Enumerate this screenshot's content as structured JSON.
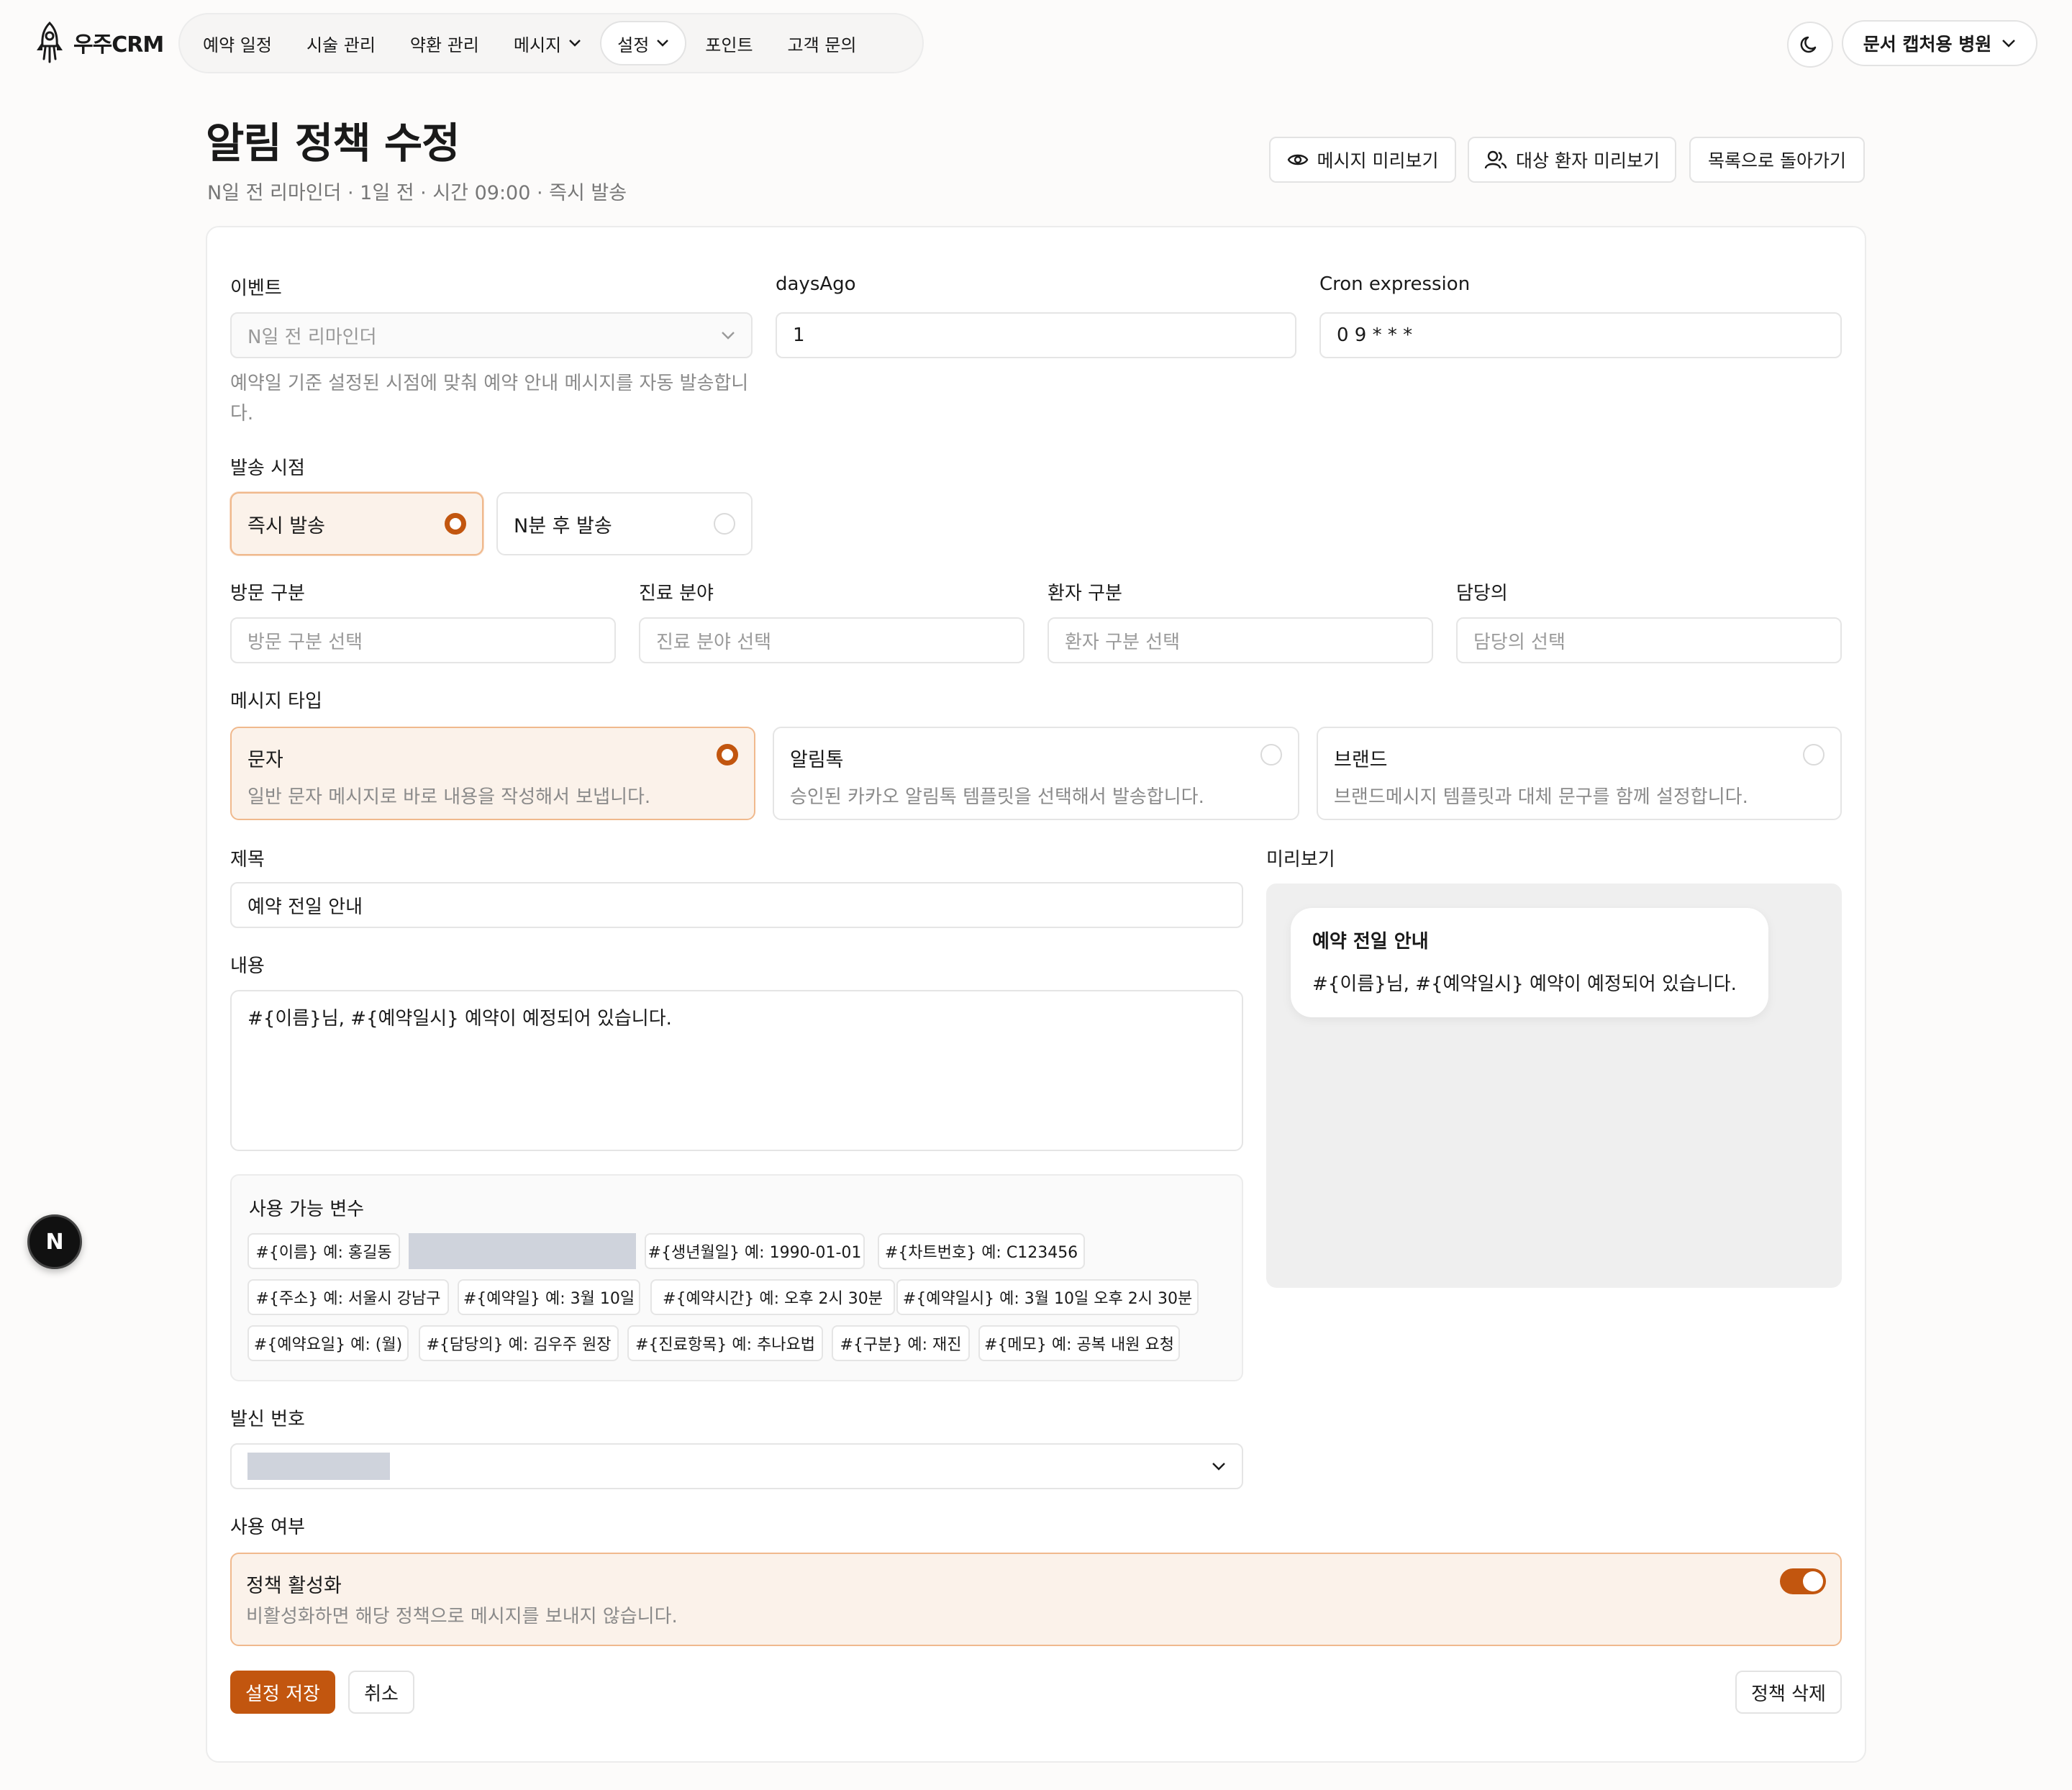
{
  "brand": {
    "name": "우주CRM"
  },
  "nav": {
    "items": [
      {
        "label": "예약 일정"
      },
      {
        "label": "시술 관리"
      },
      {
        "label": "약환 관리"
      },
      {
        "label": "메시지"
      },
      {
        "label": "설정"
      },
      {
        "label": "포인트"
      },
      {
        "label": "고객 문의"
      }
    ],
    "active": "설정"
  },
  "org": {
    "name": "문서 캡처용 병원"
  },
  "page": {
    "title": "알림 정책 수정",
    "subtitle": "N일 전 리마인더 · 1일 전 · 시간 09:00 · 즉시 발송"
  },
  "header_buttons": {
    "preview_message": "메시지 미리보기",
    "preview_patients": "대상 환자 미리보기",
    "back_to_list": "목록으로 돌아가기"
  },
  "form": {
    "event": {
      "label": "이벤트",
      "value": "N일 전 리마인더",
      "help": "예약일 기준 설정된 시점에 맞춰 예약 안내 메시지를 자동 발송합니",
      "help_wrap": "다."
    },
    "days_ago": {
      "label": "daysAgo",
      "value": "1"
    },
    "cron": {
      "label": "Cron expression",
      "value": "0 9 * * *"
    },
    "send_timing": {
      "label": "발송 시점",
      "options": [
        {
          "label": "즉시 발송",
          "selected": true
        },
        {
          "label": "N분 후 발송",
          "selected": false
        }
      ]
    },
    "filters": [
      {
        "label": "방문 구분",
        "placeholder": "방문 구분 선택"
      },
      {
        "label": "진료 분야",
        "placeholder": "진료 분야 선택"
      },
      {
        "label": "환자 구분",
        "placeholder": "환자 구분 선택"
      },
      {
        "label": "담당의",
        "placeholder": "담당의 선택"
      }
    ],
    "message_type": {
      "label": "메시지 타입",
      "options": [
        {
          "title": "문자",
          "desc": "일반 문자 메시지로 바로 내용을 작성해서 보냅니다.",
          "selected": true
        },
        {
          "title": "알림톡",
          "desc": "승인된 카카오 알림톡 템플릿을 선택해서 발송합니다.",
          "selected": false
        },
        {
          "title": "브랜드",
          "desc": "브랜드메시지 템플릿과 대체 문구를 함께 설정합니다.",
          "selected": false
        }
      ]
    },
    "subject": {
      "label": "제목",
      "value": "예약 전일 안내"
    },
    "content": {
      "label": "내용",
      "value": "#{이름}님, #{예약일시} 예약이 예정되어 있습니다."
    },
    "variables": {
      "label": "사용 가능 변수",
      "chips": [
        "#{이름} 예: 홍길동",
        "#{생년월일} 예: 1990-01-01",
        "#{차트번호} 예: C123456",
        "#{주소} 예: 서울시 강남구",
        "#{예약일} 예: 3월 10일",
        "#{예약시간} 예: 오후 2시 30분",
        "#{예약일시} 예: 3월 10일 오후 2시 30분",
        "#{예약요일} 예: (월)",
        "#{담당의} 예: 김우주 원장",
        "#{진료항목} 예: 추나요법",
        "#{구분} 예: 재진",
        "#{메모} 예: 공복 내원 요청"
      ]
    },
    "sender": {
      "label": "발신 번호"
    },
    "enabled": {
      "label": "사용 여부",
      "title": "정책 활성화",
      "desc": "비활성화하면 해당 정책으로 메시지를 보내지 않습니다.",
      "on": true
    }
  },
  "preview": {
    "label": "미리보기",
    "title": "예약 전일 안내",
    "body": "#{이름}님, #{예약일시} 예약이 예정되어 있습니다."
  },
  "actions": {
    "save": "설정 저장",
    "cancel": "취소",
    "delete": "정책 삭제"
  },
  "dev_badge": {
    "label": "N"
  },
  "colors": {
    "accent": "#c2560f",
    "accent_soft": "#fbf2ea",
    "accent_border": "#f0b98d"
  }
}
